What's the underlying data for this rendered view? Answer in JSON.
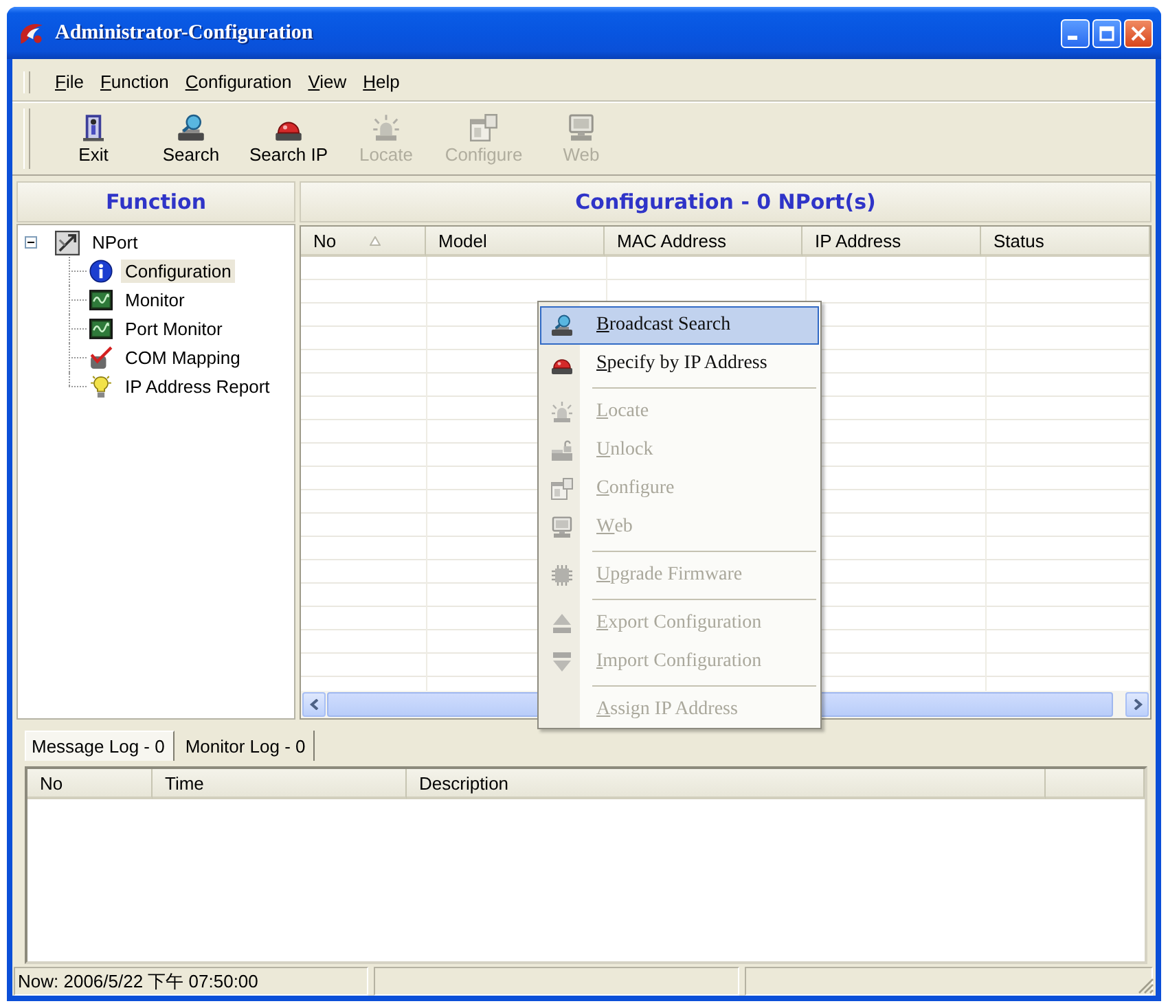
{
  "window": {
    "title": "Administrator-Configuration"
  },
  "menu_bar": [
    {
      "label": "File",
      "underline_first": true
    },
    {
      "label": "Function",
      "underline_first": true
    },
    {
      "label": "Configuration",
      "underline_first": true
    },
    {
      "label": "View",
      "underline_first": true
    },
    {
      "label": "Help",
      "underline_first": true
    }
  ],
  "toolbar": [
    {
      "kind": "exit",
      "label": "Exit",
      "disabled": false
    },
    {
      "kind": "search",
      "label": "Search",
      "disabled": false
    },
    {
      "kind": "search_ip",
      "label": "Search IP",
      "disabled": false
    },
    {
      "kind": "locate",
      "label": "Locate",
      "disabled": true
    },
    {
      "kind": "configure",
      "label": "Configure",
      "disabled": true
    },
    {
      "kind": "web",
      "label": "Web",
      "disabled": true
    }
  ],
  "function_panel": {
    "title": "Function",
    "tree": [
      {
        "kind": "device",
        "label": "NPort",
        "expanded": true,
        "selected": false,
        "children": [
          {
            "kind": "info",
            "label": "Configuration",
            "selected": true
          },
          {
            "kind": "monitor",
            "label": "Monitor",
            "selected": false
          },
          {
            "kind": "monitor",
            "label": "Port Monitor",
            "selected": false
          },
          {
            "kind": "mapping",
            "label": "COM Mapping",
            "selected": false
          },
          {
            "kind": "report",
            "label": "IP Address Report",
            "selected": false
          }
        ]
      }
    ]
  },
  "configuration_panel": {
    "title": "Configuration - 0 NPort(s)",
    "columns": [
      {
        "label": "No",
        "sorted": true
      },
      {
        "label": "Model",
        "sorted": false
      },
      {
        "label": "MAC Address",
        "sorted": false
      },
      {
        "label": "IP Address",
        "sorted": false
      },
      {
        "label": "Status",
        "sorted": false
      }
    ]
  },
  "context_menu": [
    {
      "kind": "search",
      "label": "Broadcast Search",
      "underline_first": true,
      "disabled": false,
      "selected": true,
      "separator_before": false
    },
    {
      "kind": "search_ip",
      "label": "Specify by IP Address",
      "underline_first": true,
      "disabled": false,
      "selected": false,
      "separator_before": false
    },
    {
      "kind": "locate",
      "label": "Locate",
      "underline_first": true,
      "disabled": true,
      "selected": false,
      "separator_before": true
    },
    {
      "kind": "unlock",
      "label": "Unlock",
      "underline_first": true,
      "disabled": true,
      "selected": false,
      "separator_before": false
    },
    {
      "kind": "configure",
      "label": "Configure",
      "underline_first": true,
      "disabled": true,
      "selected": false,
      "separator_before": false
    },
    {
      "kind": "web",
      "label": "Web",
      "underline_first": true,
      "disabled": true,
      "selected": false,
      "separator_before": false
    },
    {
      "kind": "firmware",
      "label": "Upgrade Firmware",
      "underline_first": true,
      "disabled": true,
      "selected": false,
      "separator_before": true
    },
    {
      "kind": "export",
      "label": "Export Configuration",
      "underline_first": true,
      "disabled": true,
      "selected": false,
      "separator_before": true
    },
    {
      "kind": "import",
      "label": "Import Configuration",
      "underline_first": true,
      "disabled": true,
      "selected": false,
      "separator_before": false
    },
    {
      "kind": "plain",
      "label": "Assign IP Address",
      "underline_first": true,
      "disabled": true,
      "selected": false,
      "separator_before": true
    }
  ],
  "log_tabs": [
    {
      "label": "Message Log - 0",
      "selected": true
    },
    {
      "label": "Monitor Log - 0",
      "selected": false
    }
  ],
  "log_table": {
    "columns": [
      "No",
      "Time",
      "Description"
    ]
  },
  "status_bar": {
    "text": "Now: 2006/5/22 下午 07:50:00"
  }
}
